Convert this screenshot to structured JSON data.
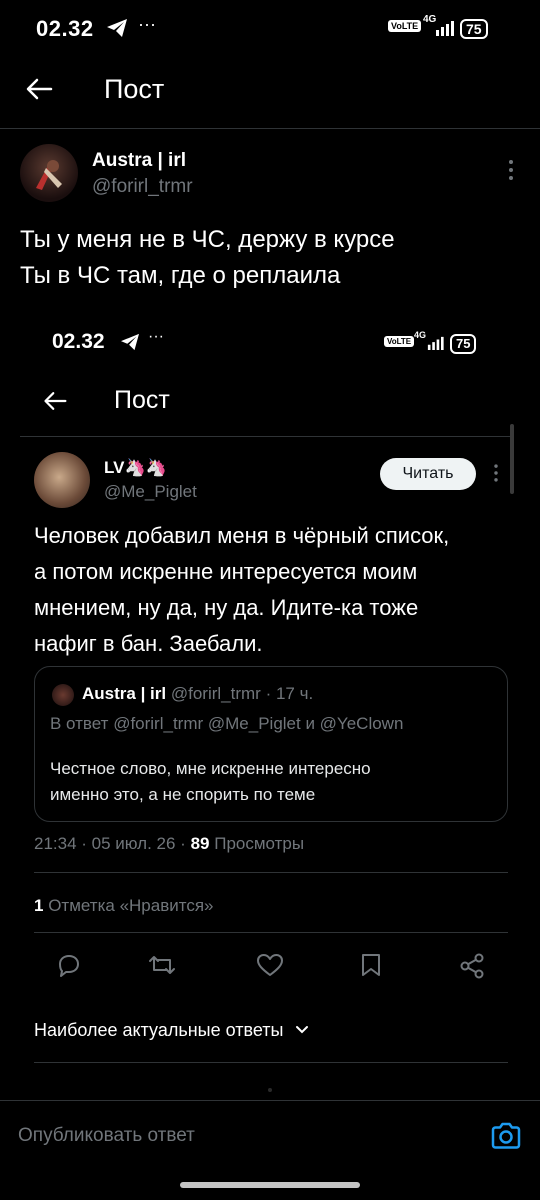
{
  "status_bar": {
    "time": "02.32",
    "dots": "···",
    "volte": "VoLTE",
    "network": "4G",
    "battery": "75"
  },
  "header": {
    "title": "Пост"
  },
  "post": {
    "author_name": "Austra | irl",
    "author_handle": "@forirl_trmr",
    "text_line1": "Ты у меня не в ЧС, держу в курсе",
    "text_line2": "Ты в ЧС там, где о реплаила"
  },
  "embedded": {
    "status_bar": {
      "time": "02.32",
      "dots": "···",
      "volte": "VoLTE",
      "network": "4G",
      "battery": "75"
    },
    "header": {
      "title": "Пост"
    },
    "tweet": {
      "author_name": "LV🦄🦄",
      "author_handle": "@Me_Piglet",
      "follow_label": "Читать",
      "text_line1": "Человек добавил меня в чёрный список,",
      "text_line2": "а потом искренне интересуется моим",
      "text_line3": "мнением, ну да, ну да. Идите-ка тоже",
      "text_line4": "нафиг в бан. Заебали."
    },
    "quote": {
      "author_name": "Austra | irl",
      "author_handle": "@forirl_trmr",
      "time": "· 17 ч.",
      "reply_prefix": "В ответ",
      "reply_to": "@forirl_trmr @Me_Piglet и @YeClown",
      "text_line1": "Честное слово, мне искренне интересно",
      "text_line2": "именно это, а не спорить по теме"
    },
    "meta": {
      "time_date": "21:34 · 05 июл. 26 ·",
      "views_count": "89",
      "views_label": "Просмотры"
    },
    "likes": {
      "count": "1",
      "label": "Отметка «Нравится»"
    },
    "sort": {
      "label": "Наиболее актуальные ответы"
    }
  },
  "reply_bar": {
    "placeholder": "Опубликовать ответ"
  },
  "colors": {
    "accent": "#1d9bf0",
    "muted": "#71767b",
    "border": "#2f3336"
  }
}
